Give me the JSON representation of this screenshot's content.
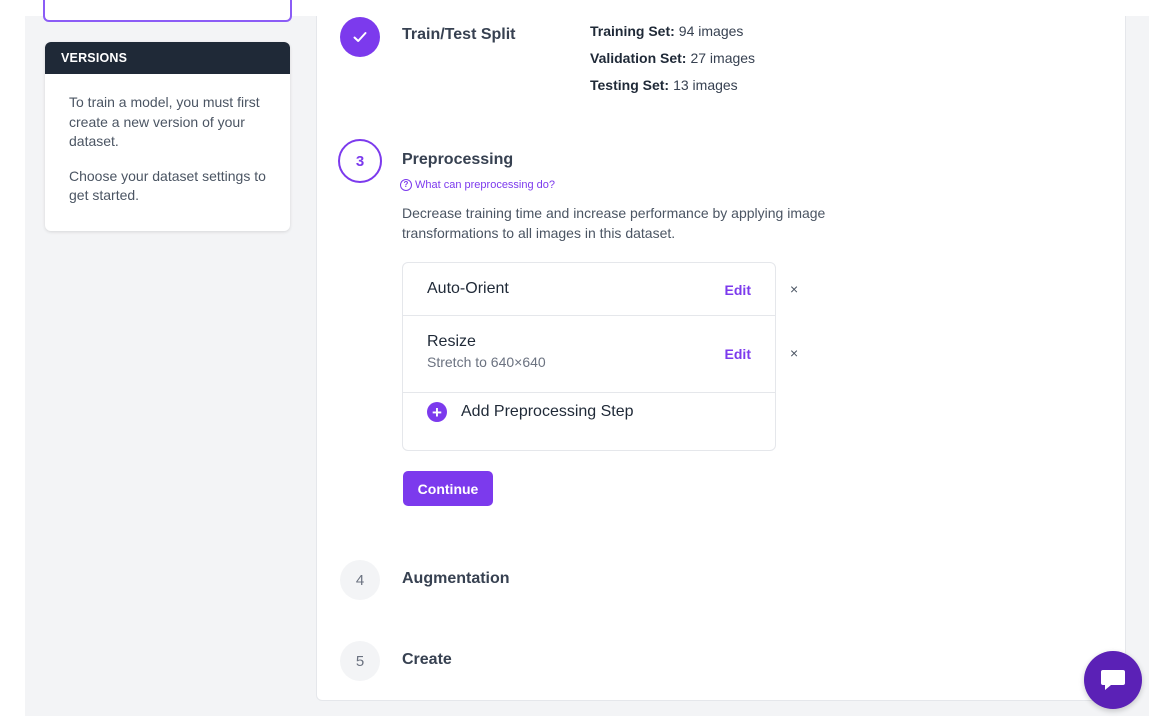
{
  "sidebar": {
    "versions_header": "VERSIONS",
    "info_paragraph_1": "To train a model, you must first create a new version of your dataset.",
    "info_paragraph_2": "Choose your dataset settings to get started."
  },
  "steps": {
    "train_test_split": {
      "title": "Train/Test Split",
      "status_icon": "checkmark-icon",
      "training_label": "Training Set:",
      "training_value": "94 images",
      "validation_label": "Validation Set:",
      "validation_value": "27 images",
      "testing_label": "Testing Set:",
      "testing_value": "13 images"
    },
    "preprocessing": {
      "number": "3",
      "title": "Preprocessing",
      "help_link": "What can preprocessing do?",
      "description": "Decrease training time and increase performance by applying image transformations to all images in this dataset.",
      "items": [
        {
          "name": "Auto-Orient",
          "detail": "",
          "edit_label": "Edit",
          "remove_label": "×"
        },
        {
          "name": "Resize",
          "detail": "Stretch to 640×640",
          "edit_label": "Edit",
          "remove_label": "×"
        }
      ],
      "add_step_label": "Add Preprocessing Step",
      "continue_label": "Continue"
    },
    "augmentation": {
      "number": "4",
      "title": "Augmentation"
    },
    "create": {
      "number": "5",
      "title": "Create"
    }
  },
  "colors": {
    "accent": "#7c3aed",
    "dark_header": "#1f2937",
    "chat_button": "#5b21b6"
  },
  "chat": {
    "icon": "chat-bubble-icon"
  }
}
